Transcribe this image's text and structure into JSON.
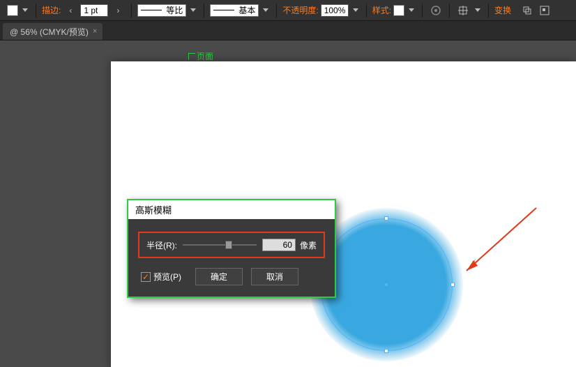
{
  "toolbar": {
    "stroke_label": "描边:",
    "stroke_value": "1 pt",
    "dash_label": "等比",
    "profile_label": "基本",
    "opacity_label": "不透明度:",
    "opacity_value": "100%",
    "style_label": "样式:",
    "transform_label": "变换"
  },
  "tab": {
    "title": "@ 56% (CMYK/预览)",
    "close": "×"
  },
  "page_tag": "页面",
  "dialog": {
    "title": "高斯模糊",
    "radius_label": "半径(R):",
    "radius_value": "60",
    "unit": "像素",
    "preview_label": "预览(P)",
    "ok": "确定",
    "cancel": "取消",
    "checkmark": "✓"
  }
}
